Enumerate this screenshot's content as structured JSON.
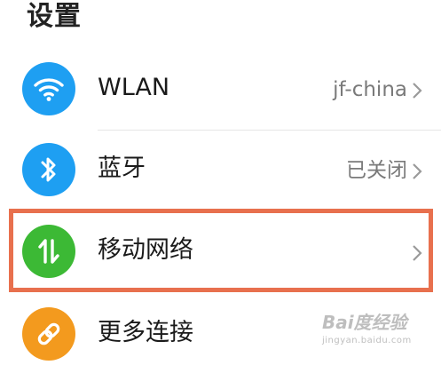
{
  "header": {
    "title": "设置"
  },
  "rows": [
    {
      "label": "WLAN",
      "value": "jf-china",
      "icon": "wifi-icon",
      "icon_color": "#1e9ff2"
    },
    {
      "label": "蓝牙",
      "value": "已关闭",
      "icon": "bluetooth-icon",
      "icon_color": "#1e9ff2"
    },
    {
      "label": "移动网络",
      "value": "",
      "icon": "mobile-data-icon",
      "icon_color": "#3cb935"
    },
    {
      "label": "更多连接",
      "value": "",
      "icon": "link-icon",
      "icon_color": "#f39a1e"
    }
  ],
  "highlight": {
    "color": "#e8704e",
    "target": "移动网络"
  },
  "watermark": {
    "logo": "Bai度经验",
    "sub": "jingyan.baidu.com"
  }
}
